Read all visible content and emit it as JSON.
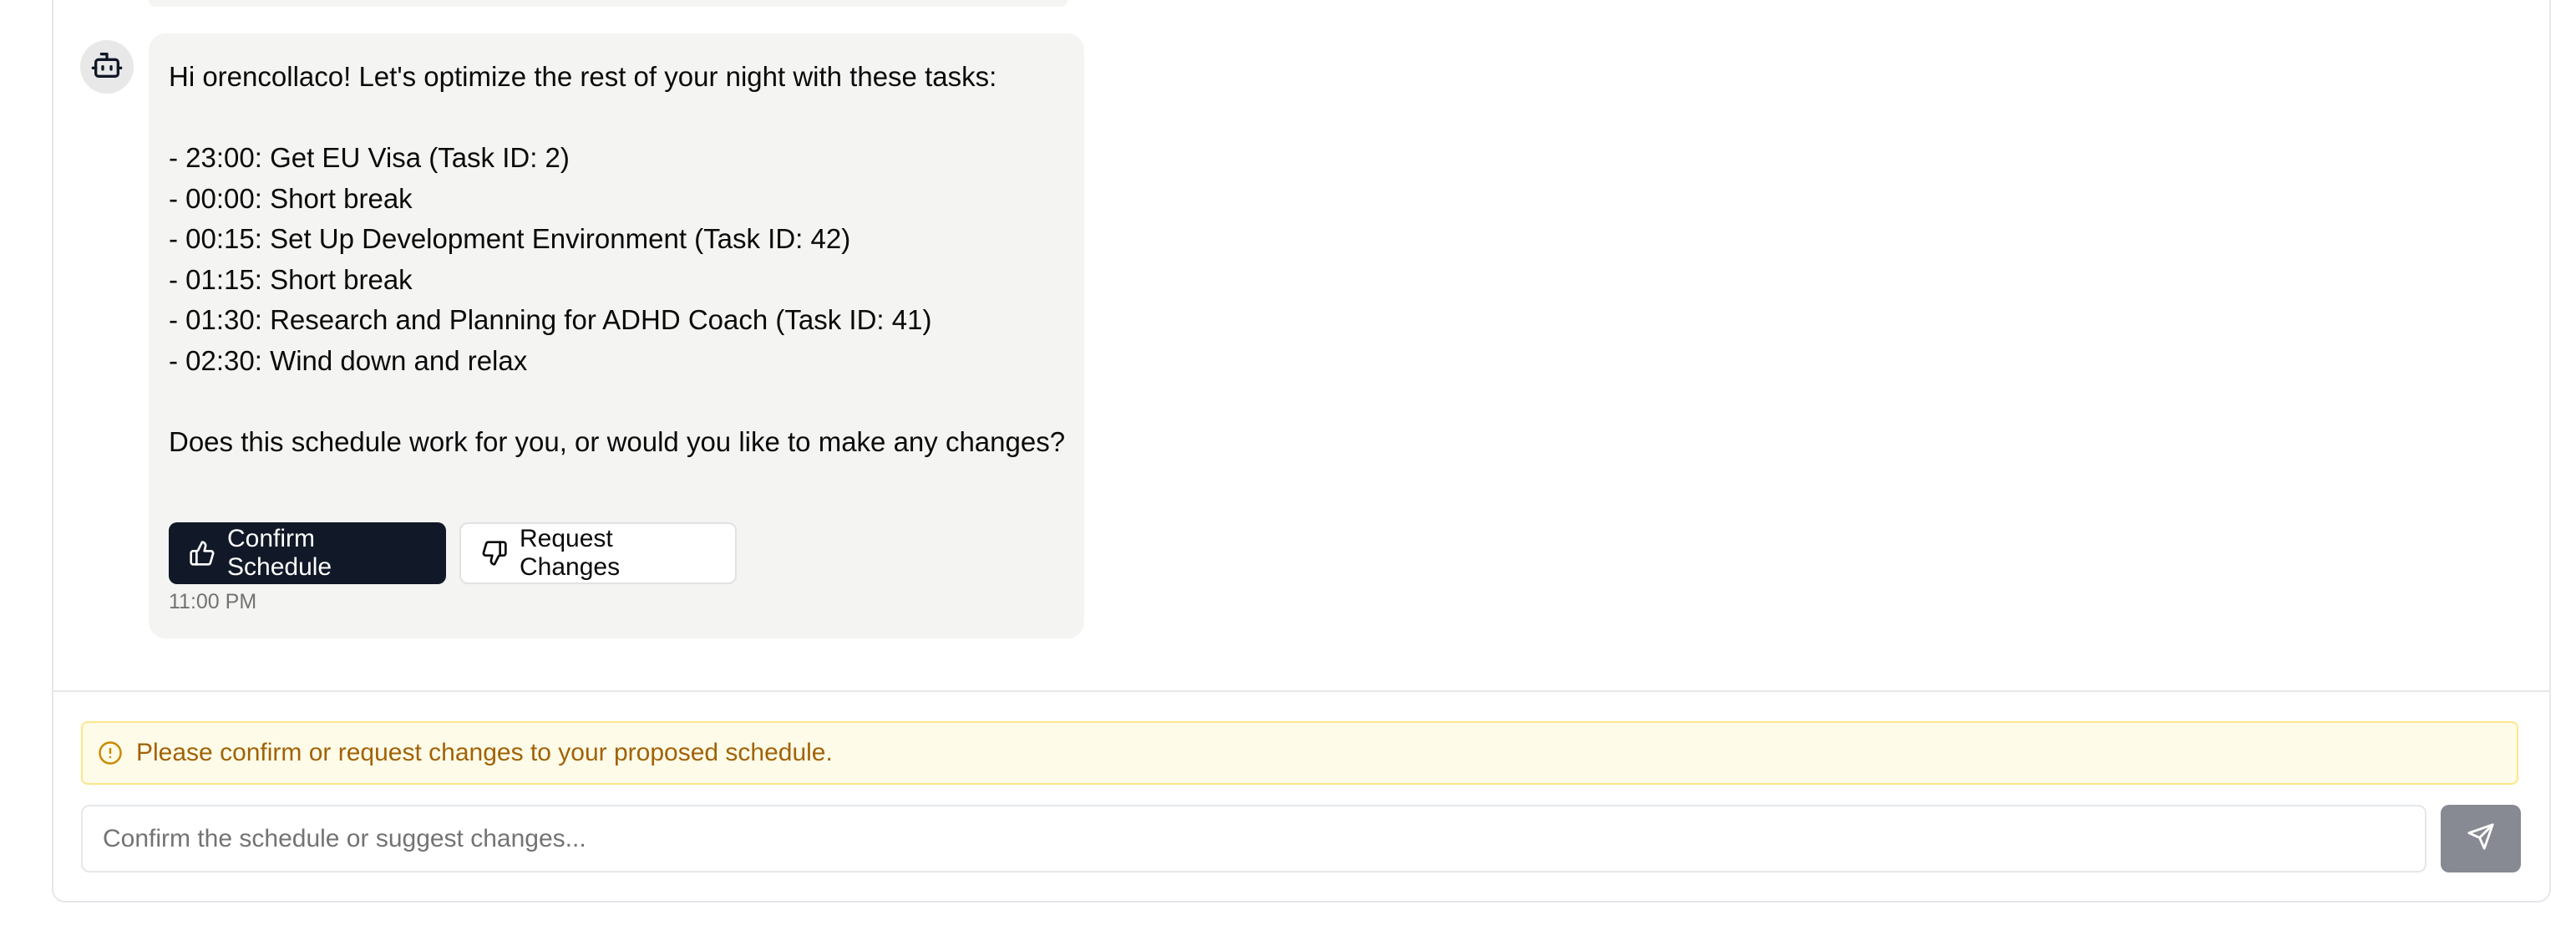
{
  "chat": {
    "assistant_avatar_icon": "bot-icon",
    "message": {
      "lines": [
        "Hi orencollaco! Let's optimize the rest of your night with these tasks:",
        "",
        "- 23:00: Get EU Visa (Task ID: 2)",
        "- 00:00: Short break",
        "- 00:15: Set Up Development Environment (Task ID: 42)",
        "- 01:15: Short break",
        "- 01:30: Research and Planning for ADHD Coach (Task ID: 41)",
        "- 02:30: Wind down and relax",
        "",
        "Does this schedule work for you, or would you like to make any changes?"
      ],
      "timestamp": "11:00 PM"
    },
    "actions": {
      "confirm": {
        "label": "Confirm Schedule",
        "icon": "thumbs-up-icon"
      },
      "request_changes": {
        "label": "Request Changes",
        "icon": "thumbs-down-icon"
      }
    }
  },
  "alert": {
    "icon": "alert-circle-icon",
    "text": "Please confirm or request changes to your proposed schedule."
  },
  "composer": {
    "value": "",
    "placeholder": "Confirm the schedule or suggest changes...",
    "send_icon": "send-icon"
  },
  "colors": {
    "primary_button": "#111827",
    "bubble_background": "#f4f4f3",
    "alert_background": "#fefce8",
    "alert_border": "#fde68a",
    "alert_text": "#a16207",
    "send_button": "#878a92"
  }
}
